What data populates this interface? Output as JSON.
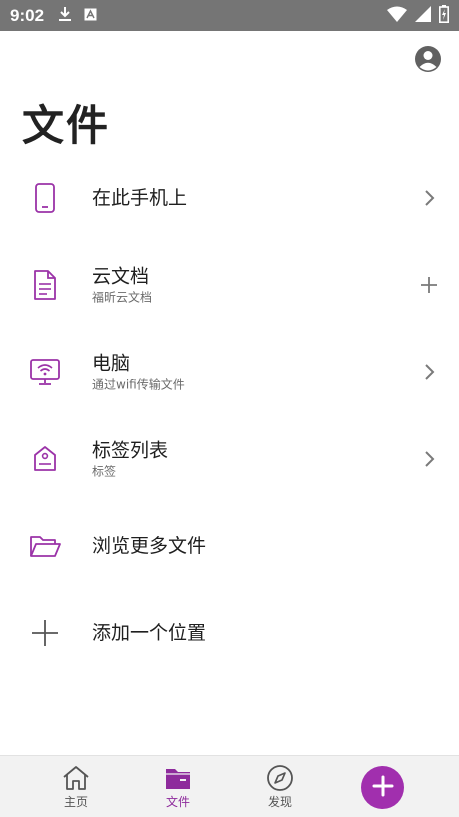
{
  "status_bar": {
    "time": "9:02",
    "icons": [
      "download-icon",
      "a-notification-icon",
      "wifi-icon",
      "signal-icon",
      "battery-charging-icon"
    ]
  },
  "header": {
    "title": "文件",
    "account_icon": "account-circle-icon"
  },
  "locations": [
    {
      "title": "在此手机上",
      "subtitle": "",
      "icon": "phone-icon",
      "action": "chevron-right-icon"
    },
    {
      "title": "云文档",
      "subtitle": "福昕云文档",
      "icon": "document-icon",
      "action": "plus-icon"
    },
    {
      "title": "电脑",
      "subtitle": "通过wifi传输文件",
      "icon": "computer-wifi-icon",
      "action": "chevron-right-icon"
    },
    {
      "title": "标签列表",
      "subtitle": "标签",
      "icon": "tag-icon",
      "action": "chevron-right-icon"
    },
    {
      "title": "浏览更多文件",
      "subtitle": "",
      "icon": "folder-open-icon",
      "action": ""
    },
    {
      "title": "添加一个位置",
      "subtitle": "",
      "icon": "plus-icon",
      "action": ""
    }
  ],
  "bottom_nav": {
    "items": [
      {
        "label": "主页",
        "icon": "home-icon",
        "active": false
      },
      {
        "label": "文件",
        "icon": "folder-icon",
        "active": true
      },
      {
        "label": "发现",
        "icon": "compass-icon",
        "active": false
      }
    ],
    "fab_icon": "plus-icon"
  },
  "colors": {
    "accent": "#a12fae",
    "status_bar": "#757575",
    "nav_background": "#f2f2f2"
  }
}
